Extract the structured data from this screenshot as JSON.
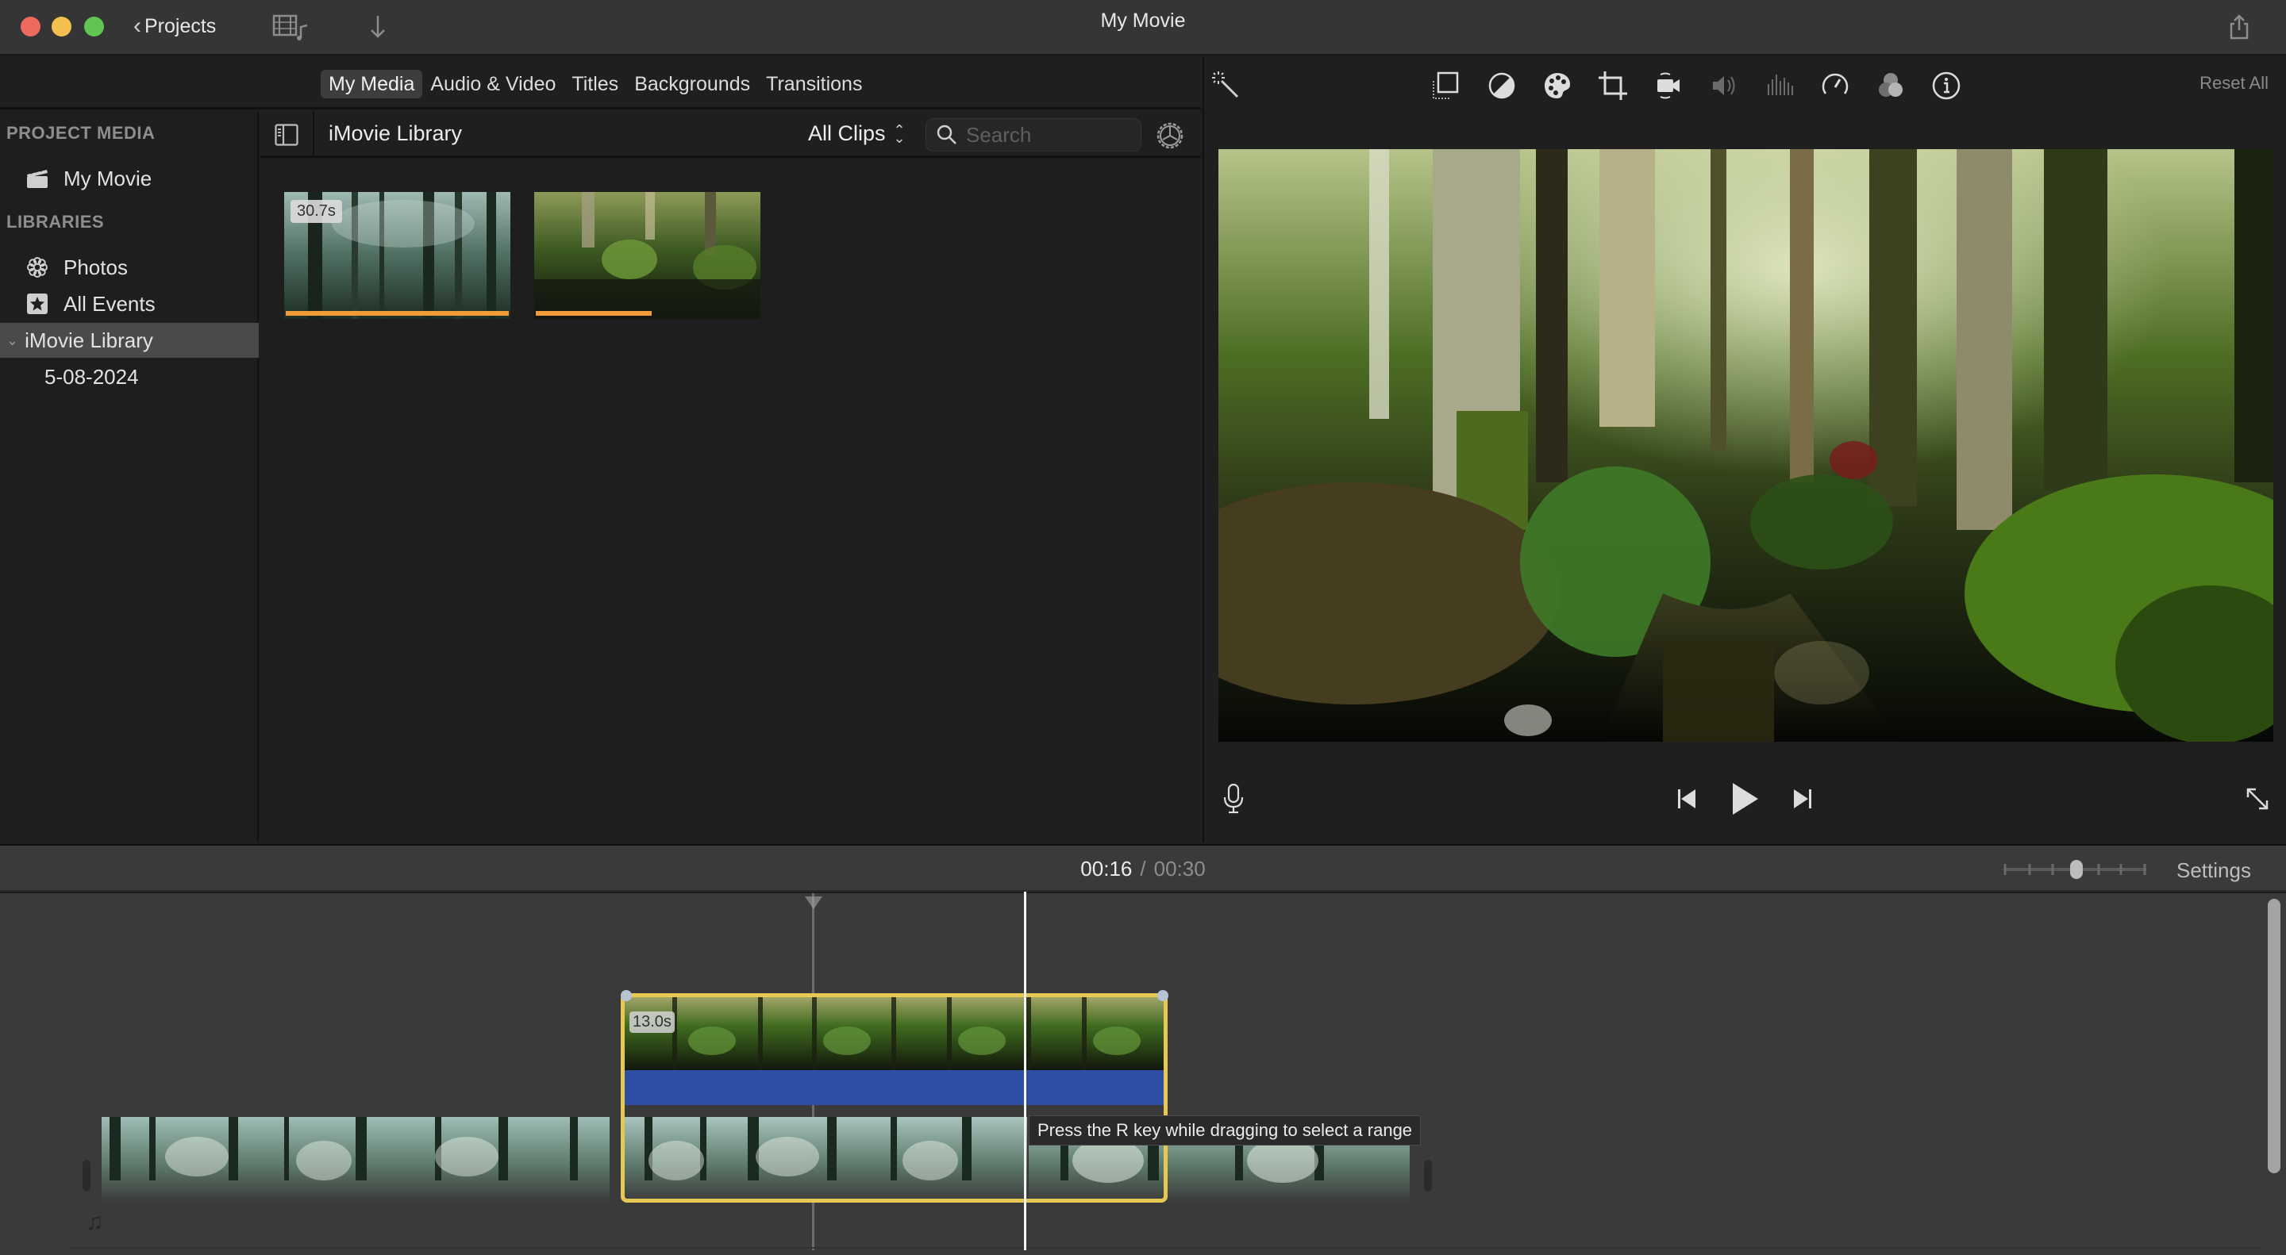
{
  "window": {
    "title": "My Movie",
    "back_label": "Projects",
    "icons": [
      "media-view-toggle-icon",
      "import-arrow-icon",
      "share-icon"
    ],
    "traffic_lights": {
      "close": "#ec6a5e",
      "minimize": "#f4bf4f",
      "zoom": "#61c554"
    }
  },
  "browser_tabs": [
    {
      "label": "My Media",
      "active": true
    },
    {
      "label": "Audio & Video",
      "active": false
    },
    {
      "label": "Titles",
      "active": false
    },
    {
      "label": "Backgrounds",
      "active": false
    },
    {
      "label": "Transitions",
      "active": false
    }
  ],
  "sidebar": {
    "project_media_heading": "PROJECT MEDIA",
    "project_items": [
      {
        "label": "My Movie",
        "icon": "clapperboard-icon"
      }
    ],
    "libraries_heading": "LIBRARIES",
    "library_items": [
      {
        "label": "Photos",
        "icon": "photos-flower-icon"
      },
      {
        "label": "All Events",
        "icon": "star-icon"
      },
      {
        "label": "iMovie Library",
        "icon": "disclosure-chevron-icon",
        "selected": true
      },
      {
        "label": "5-08-2024",
        "icon": ""
      }
    ]
  },
  "browser": {
    "title": "iMovie Library",
    "filter": "All Clips",
    "search": {
      "placeholder": "Search",
      "value": ""
    },
    "clips": [
      {
        "duration_badge": "30.7s",
        "used_fraction": 1.0,
        "scene": "misty forest"
      },
      {
        "duration_badge": "",
        "used_fraction": 0.52,
        "scene": "forest stream"
      }
    ]
  },
  "viewer": {
    "tools": [
      "magic-wand-icon",
      "crop-to-fill-icon",
      "color-balance-icon",
      "color-palette-icon",
      "crop-icon",
      "stabilization-camera-icon",
      "volume-icon",
      "equalizer-icon",
      "speed-icon",
      "clip-filter-icon",
      "info-icon"
    ],
    "reset_all_label": "Reset All",
    "controls": [
      "microphone-icon",
      "skip-back-icon",
      "play-icon",
      "skip-forward-icon",
      "fullscreen-icon"
    ]
  },
  "timeline": {
    "current_time": "00:16",
    "separator": "/",
    "total_time": "00:30",
    "settings_label": "Settings",
    "zoom_level_fraction": 0.5,
    "broll_clip": {
      "duration_badge": "13.0s",
      "border_color": "#e6c955",
      "audio_color": "#2e4fa3"
    },
    "tooltip": "Press the R key while dragging to select a range",
    "music_icon": "music-note-icon"
  }
}
